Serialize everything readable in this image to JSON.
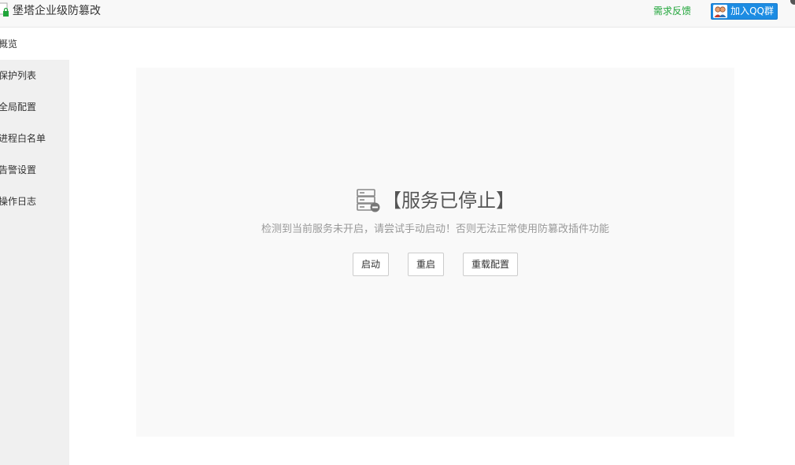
{
  "header": {
    "title": "堡塔企业级防篡改",
    "feedback_label": "需求反馈",
    "qq_label": "加入QQ群"
  },
  "sidebar": {
    "items": [
      {
        "label": "概览",
        "active": true
      },
      {
        "label": "保护列表",
        "active": false
      },
      {
        "label": "全局配置",
        "active": false
      },
      {
        "label": "进程白名单",
        "active": false
      },
      {
        "label": "告警设置",
        "active": false
      },
      {
        "label": "操作日志",
        "active": false
      }
    ]
  },
  "status": {
    "title": "【服务已停止】",
    "description": "检测到当前服务未开启，请尝试手动启动！否则无法正常使用防篡改插件功能",
    "icon": "server-stopped-icon"
  },
  "actions": {
    "start_label": "启动",
    "restart_label": "重启",
    "reload_label": "重载配置"
  },
  "colors": {
    "accent_green": "#20a53a",
    "qq_blue": "#1c8ce3",
    "sidebar_bg": "#f0f0f0",
    "panel_bg": "#f9f9f9"
  }
}
